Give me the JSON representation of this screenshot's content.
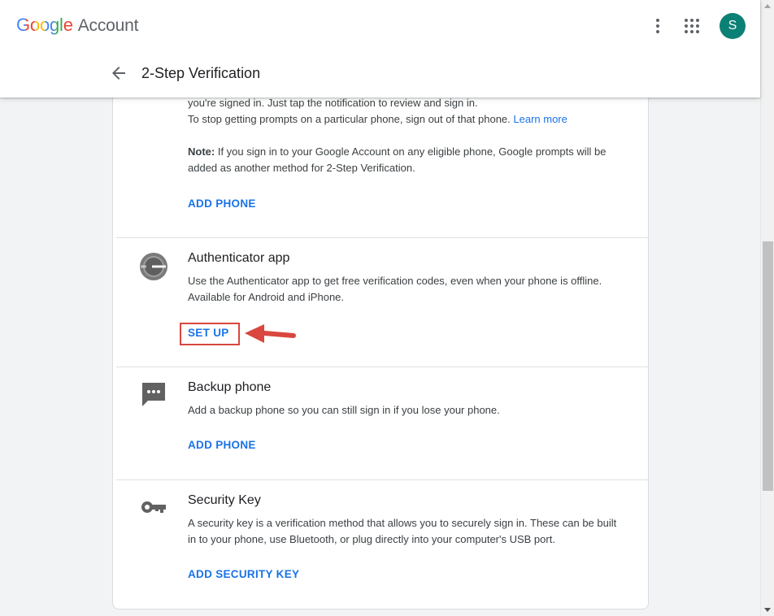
{
  "header": {
    "brand_google": "Google",
    "brand_account": "Account",
    "avatar_initial": "S",
    "page_title": "2-Step Verification"
  },
  "google_prompt": {
    "desc_line1": "you're signed in. Just tap the notification to review and sign in.",
    "desc_line2": "To stop getting prompts on a particular phone, sign out of that phone.",
    "learn_more": "Learn more",
    "note_label": "Note:",
    "note_text": " If you sign in to your Google Account on any eligible phone, Google prompts will be added as another method for 2-Step Verification.",
    "action": "ADD PHONE"
  },
  "authenticator": {
    "title": "Authenticator app",
    "desc": "Use the Authenticator app to get free verification codes, even when your phone is offline. Available for Android and iPhone.",
    "action": "SET UP"
  },
  "backup_phone": {
    "title": "Backup phone",
    "desc": "Add a backup phone so you can still sign in if you lose your phone.",
    "action": "ADD PHONE"
  },
  "security_key": {
    "title": "Security Key",
    "desc": "A security key is a verification method that allows you to securely sign in. These can be built in to your phone, use Bluetooth, or plug directly into your computer's USB port.",
    "action": "ADD SECURITY KEY"
  },
  "colors": {
    "accent": "#1a73e8",
    "avatar": "#0b8074",
    "highlight": "#d9473e"
  },
  "icons": {
    "back": "arrow-left-icon",
    "more": "more-vert-icon",
    "apps": "apps-grid-icon",
    "authenticator": "google-authenticator-icon",
    "backup": "chat-bubble-icon",
    "key": "key-icon"
  }
}
